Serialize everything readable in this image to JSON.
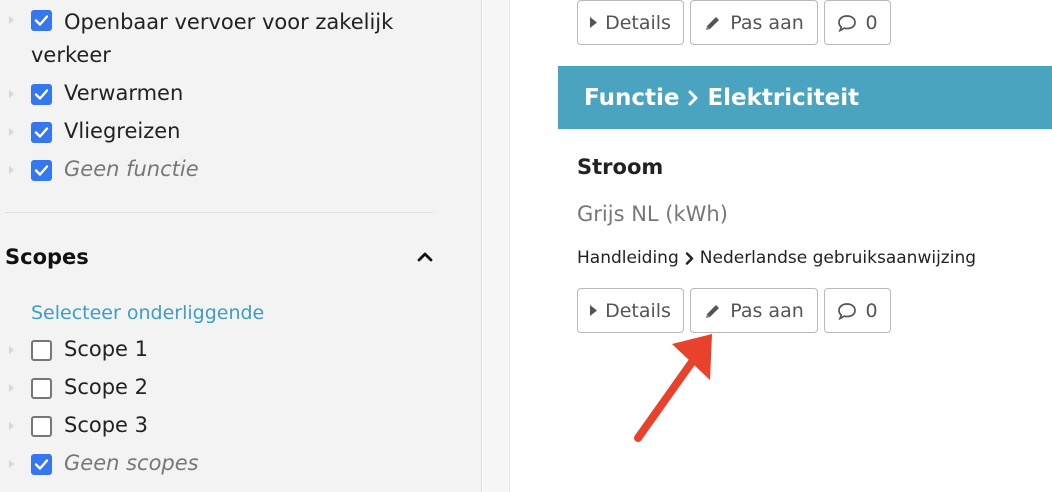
{
  "sidebar": {
    "function_items": [
      {
        "label": "Openbaar vervoer voor zakelijk verkeer",
        "checked": true
      },
      {
        "label": "Verwarmen",
        "checked": true
      },
      {
        "label": "Vliegreizen",
        "checked": true
      },
      {
        "label": "Geen functie",
        "checked": true
      }
    ],
    "scopes": {
      "title": "Scopes",
      "select_children": "Selecteer onderliggende",
      "items": [
        {
          "label": "Scope 1",
          "checked": false
        },
        {
          "label": "Scope 2",
          "checked": false
        },
        {
          "label": "Scope 3",
          "checked": false
        },
        {
          "label": "Geen scopes",
          "checked": true
        }
      ]
    }
  },
  "main": {
    "top_actions": {
      "details_label": "Details",
      "edit_label": "Pas aan",
      "comments_count": "0"
    },
    "section_banner": {
      "part1": "Functie",
      "part2": "Elektriciteit"
    },
    "item": {
      "title": "Stroom",
      "subtitle": "Grijs NL (kWh)",
      "crumb_part1": "Handleiding",
      "crumb_part2": "Nederlandse gebruiksaanwijzing",
      "details_label": "Details",
      "edit_label": "Pas aan",
      "comments_count": "0"
    }
  },
  "colors": {
    "accent_banner": "#4aa3bf",
    "checkbox_checked": "#3577f0",
    "link": "#3a9fc3",
    "annotation_arrow": "#e8412c"
  }
}
